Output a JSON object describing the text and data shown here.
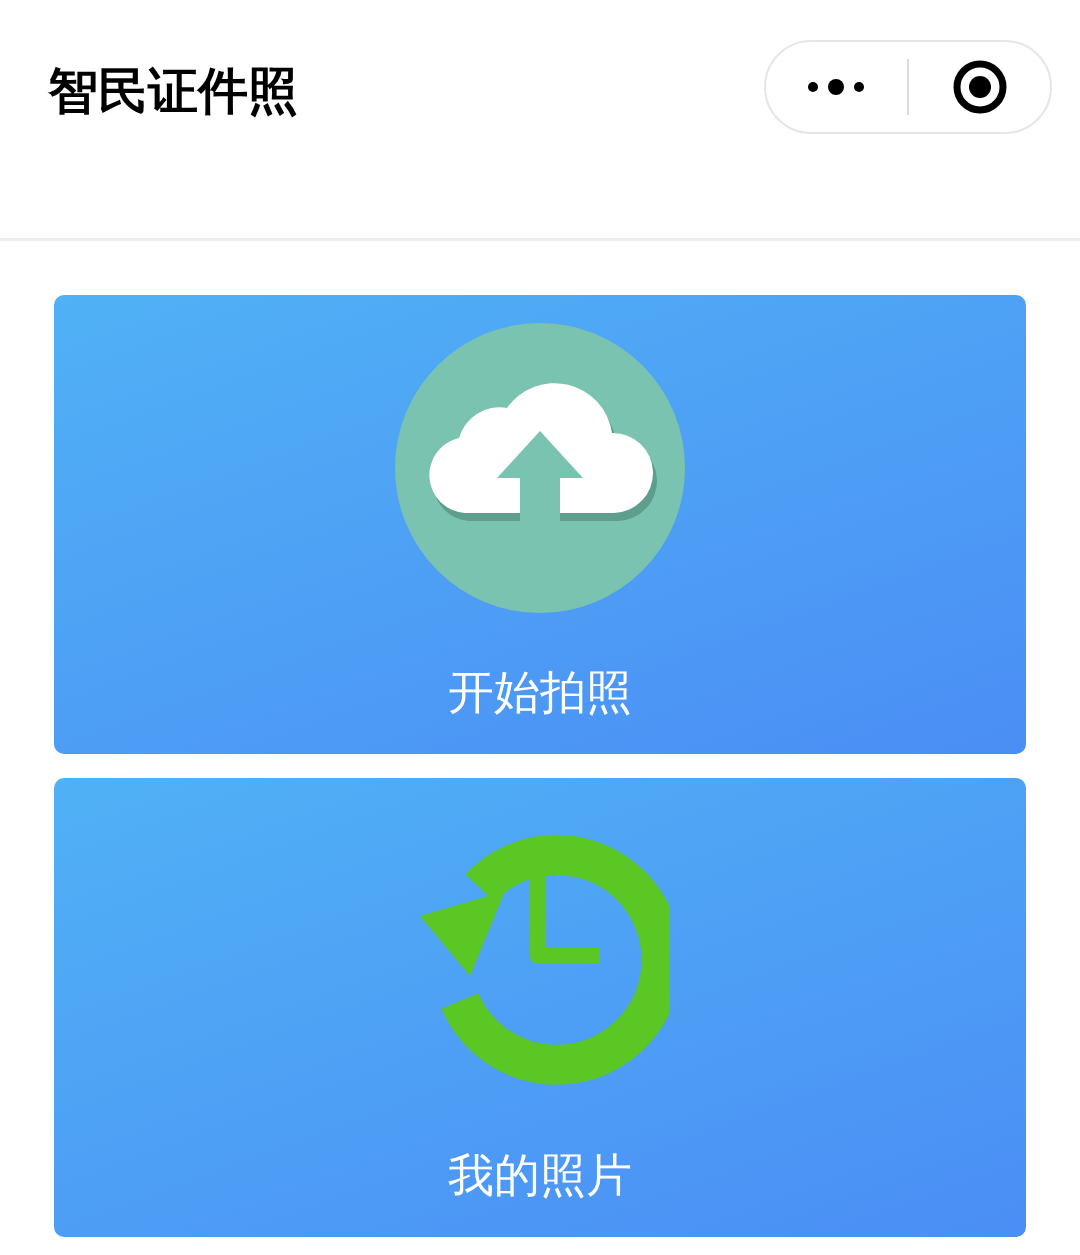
{
  "navbar": {
    "title": "智民证件照"
  },
  "cards": [
    {
      "kind": "upload",
      "label": "开始拍照"
    },
    {
      "kind": "history",
      "label": "我的照片"
    }
  ]
}
